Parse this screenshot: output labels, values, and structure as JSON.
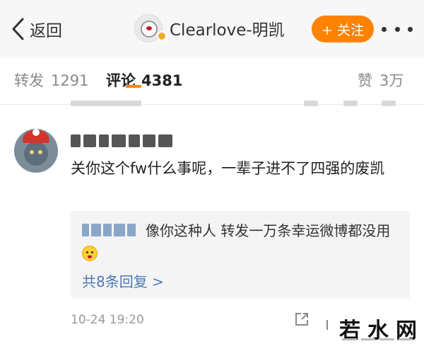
{
  "navbar": {
    "back_label": "返回",
    "title": "Clearlove-明凯",
    "follow_label": "+ 关注"
  },
  "tabs": {
    "reposts_label": "转发",
    "reposts_count": "1291",
    "comments_label": "评论",
    "comments_count": "4381",
    "likes_label": "赞",
    "likes_count": "3万"
  },
  "comment": {
    "text": "关你这个fw什么事呢，一辈子进不了四强的废凯",
    "replies": {
      "text": "像你这种人  转发一万条幸运微博都没用",
      "count_label": "共8条回复 >"
    },
    "timestamp": "10-24 19:20"
  },
  "watermark": {
    "text": "若水网"
  },
  "colors": {
    "accent": "#ff8200",
    "link": "#4a7ab6",
    "navbar_bg": "#f7f7f7"
  },
  "icons": {
    "back": "chevron-left-icon",
    "more": "more-dots-icon",
    "share": "share-icon",
    "emoji": "laughing-emoji-icon",
    "verified": "verified-badge-icon"
  }
}
